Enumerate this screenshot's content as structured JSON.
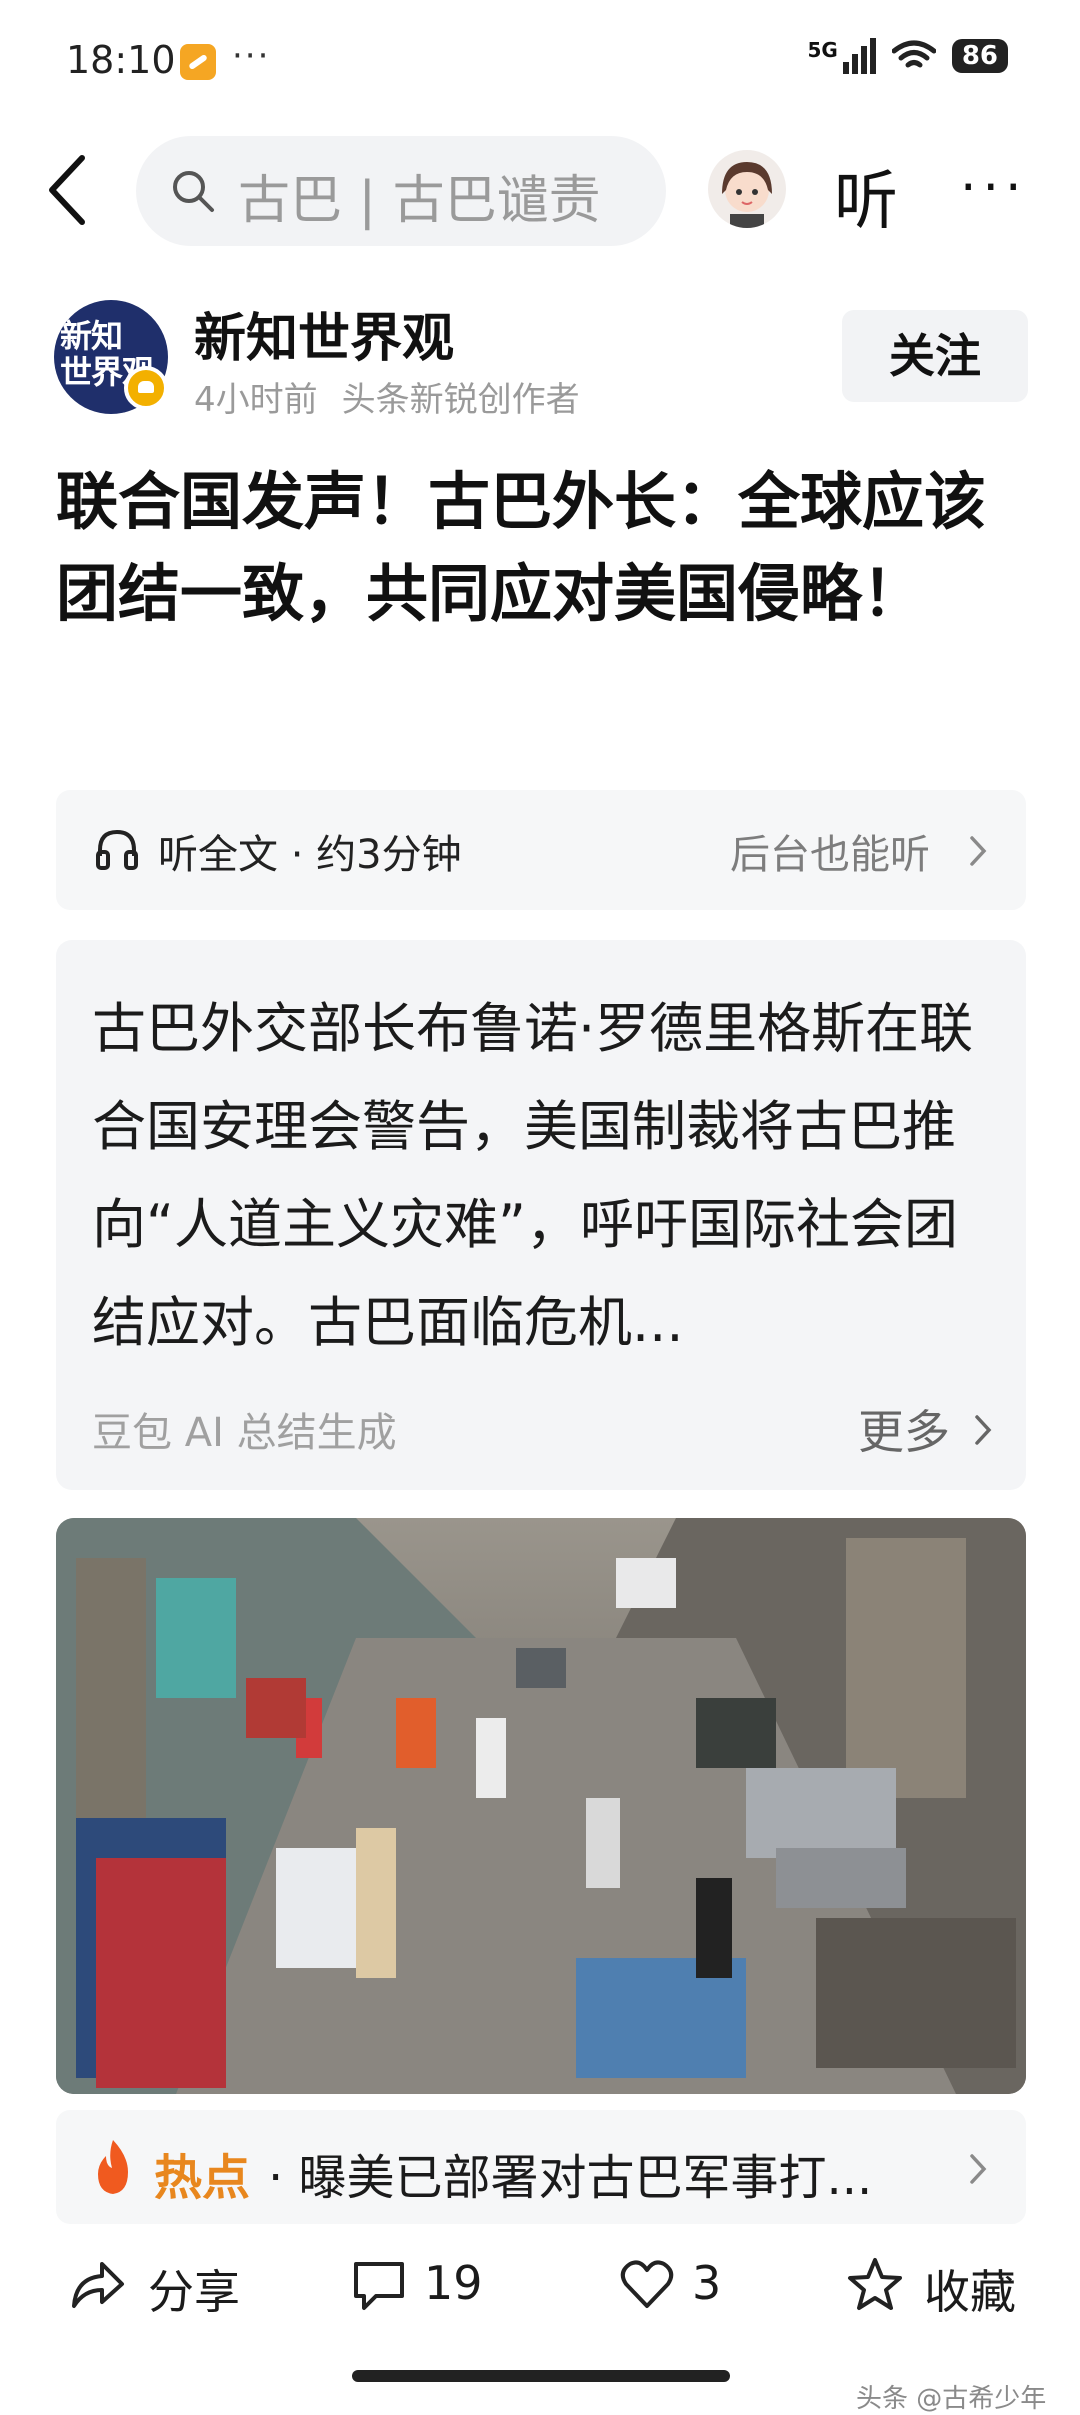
{
  "status": {
    "time": "18:10",
    "dots": "···",
    "network": "5G",
    "battery": "86"
  },
  "nav": {
    "search_text": "古巴 | 古巴谴责",
    "listen": "听",
    "more": "···"
  },
  "author": {
    "logo_text_1": "新知",
    "logo_text_2": "世界观",
    "name": "新知世界观",
    "time": "4小时前",
    "role": "头条新锐创作者",
    "follow": "关注"
  },
  "article": {
    "title": "联合国发声！古巴外长：全球应该团结一致，共同应对美国侵略！"
  },
  "listen_bar": {
    "label": "听全文 · 约3分钟",
    "background": "后台也能听"
  },
  "summary": {
    "text": "古巴外交部长布鲁诺·罗德里格斯在联合国安理会警告，美国制裁将古巴推向“人道主义灾难”，呼吁国际社会团结应对。古巴面临危机...",
    "source": "豆包 AI 总结生成",
    "more": "更多"
  },
  "hot": {
    "label": "热点",
    "text": "· 曝美已部署对古巴军事打..."
  },
  "actions": {
    "share": "分享",
    "comments": "19",
    "likes": "3",
    "favorite": "收藏"
  },
  "watermark": "头条 @古希少年"
}
